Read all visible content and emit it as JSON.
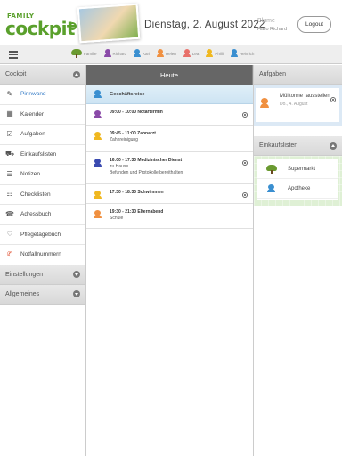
{
  "header": {
    "logo_small": "FAMILY",
    "logo_big": "cockpit",
    "date": "Dienstag, 2. August 2022",
    "user_name": "Blume",
    "greeting": "Hallo Richard",
    "logout_label": "Logout"
  },
  "family": [
    {
      "name": "Familie",
      "color": "#6a9a30",
      "icon": "tree-icon"
    },
    {
      "name": "Richard",
      "color": "#8a4aa8"
    },
    {
      "name": "Kari",
      "color": "#3a8fd0"
    },
    {
      "name": "Helen",
      "color": "#f09040"
    },
    {
      "name": "Lea",
      "color": "#e8706a"
    },
    {
      "name": "Philli",
      "color": "#f0b820"
    },
    {
      "name": "Heinrich",
      "color": "#3a8fd0"
    }
  ],
  "sidebar": {
    "section_title": "Cockpit",
    "items": [
      {
        "label": "Pinnwand",
        "icon": "pin-icon",
        "glyph": "✎"
      },
      {
        "label": "Kalender",
        "icon": "calendar-icon",
        "glyph": "▦"
      },
      {
        "label": "Aufgaben",
        "icon": "checklist-icon",
        "glyph": "☑"
      },
      {
        "label": "Einkaufslisten",
        "icon": "cart-icon",
        "glyph": "⛟"
      },
      {
        "label": "Notizen",
        "icon": "notes-icon",
        "glyph": "☰"
      },
      {
        "label": "Checklisten",
        "icon": "checklist-doc-icon",
        "glyph": "☷"
      },
      {
        "label": "Adressbuch",
        "icon": "addressbook-icon",
        "glyph": "☎"
      },
      {
        "label": "Pflegetagebuch",
        "icon": "heart-icon",
        "glyph": "♡"
      },
      {
        "label": "Notfallnummern",
        "icon": "emergency-icon",
        "glyph": "✆"
      }
    ],
    "section_settings": "Einstellungen",
    "section_general": "Allgemeines"
  },
  "main": {
    "title": "Heute",
    "banner": "Geschäftsreise",
    "events": [
      {
        "time": "09:00 - 10:00",
        "title": "Notartermin",
        "sub": "",
        "note": "",
        "color": "#8a4aa8",
        "flag": true
      },
      {
        "time": "09:45 - 11:00",
        "title": "Zahnarzt",
        "sub": "Zahnreinigung",
        "note": "",
        "color": "#f0b820",
        "flag": false
      },
      {
        "time": "16:00 - 17:30",
        "title": "Medizinischer Dienst",
        "sub": "zu Hause",
        "note": "Befunden und Protokolle bereithalten",
        "color": "#3a4ab0",
        "flag": true
      },
      {
        "time": "17:30 - 18:30",
        "title": "Schwimmen",
        "sub": "",
        "note": "",
        "color": "#f0b820",
        "flag": true
      },
      {
        "time": "19:30 - 21:30",
        "title": "Elternabend",
        "sub": "Schule",
        "note": "",
        "color": "#f09040",
        "flag": false
      }
    ]
  },
  "right": {
    "tasks_title": "Aufgaben",
    "task": {
      "title": "Mülltonne rausstellen",
      "date": "Do., 4. August"
    },
    "shopping_title": "Einkaufslisten",
    "shopping": [
      {
        "label": "Supermarkt",
        "icon": "tree"
      },
      {
        "label": "Apotheke",
        "icon": "person"
      }
    ]
  }
}
